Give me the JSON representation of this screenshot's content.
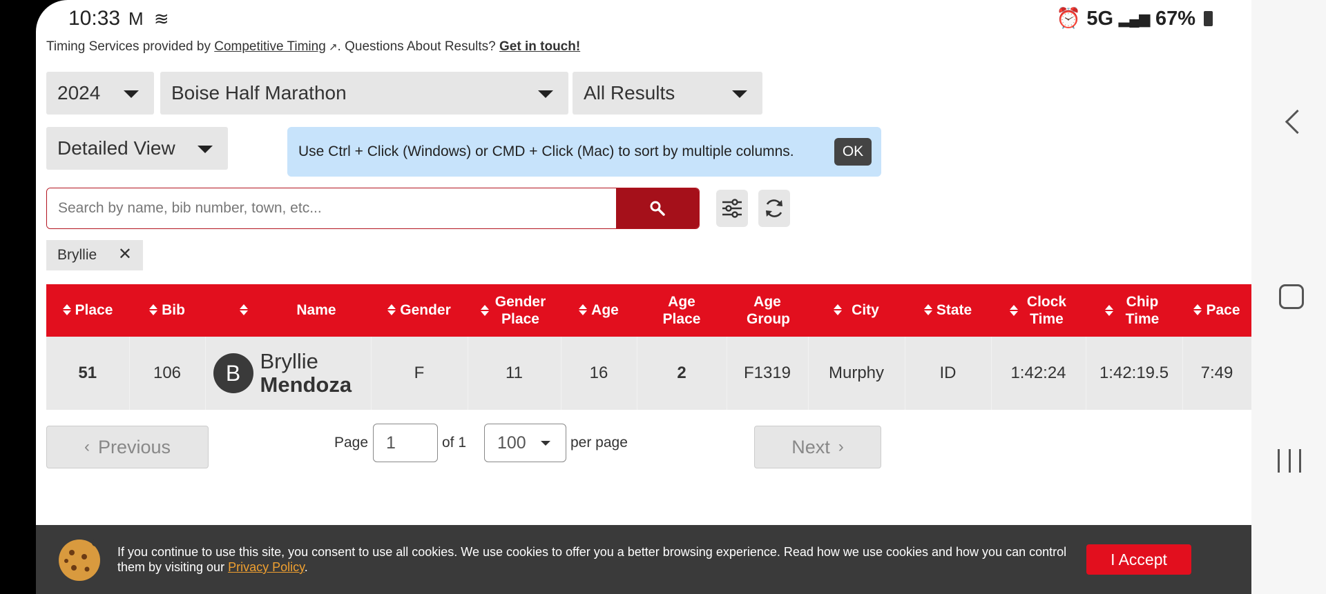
{
  "status_bar": {
    "time": "10:33",
    "left_icons": "M ≋",
    "network": "5G",
    "battery": "67%"
  },
  "credit": {
    "prefix": "Timing Services provided by ",
    "link": "Competitive Timing",
    "middle": ". Questions About Results? ",
    "contact": "Get in touch!"
  },
  "filters": {
    "year": "2024",
    "race": "Boise Half Marathon",
    "results": "All Results",
    "view": "Detailed View"
  },
  "tip": {
    "text": "Use Ctrl + Click (Windows) or CMD + Click (Mac) to sort by multiple columns.",
    "ok": "OK"
  },
  "search": {
    "placeholder": "Search by name, bib number, town, etc...",
    "value": ""
  },
  "active_filter": {
    "label": "Bryllie",
    "remove": "✕"
  },
  "table": {
    "headers": [
      "Place",
      "Bib",
      "Name",
      "Gender",
      "Gender Place",
      "Age",
      "Age Place",
      "Age Group",
      "City",
      "State",
      "Clock Time",
      "Chip Time",
      "Pace"
    ],
    "row": {
      "place": "51",
      "bib": "106",
      "avatar": "B",
      "first": "Bryllie",
      "last": "Mendoza",
      "gender": "F",
      "gender_place": "11",
      "age": "16",
      "age_place": "2",
      "age_group": "F1319",
      "city": "Murphy",
      "state": "ID",
      "clock_time": "1:42:24",
      "chip_time": "1:42:19.5",
      "pace": "7:49"
    }
  },
  "pager": {
    "previous": "Previous",
    "page_label": "Page",
    "page_value": "1",
    "of_label": "of 1",
    "per_page_value": "100",
    "per_page_label": "per page",
    "next": "Next"
  },
  "cookie": {
    "text": "If you continue to use this site, you consent to use all cookies. We use cookies to offer you a better browsing experience. Read how we use cookies and how you can control them by visiting our ",
    "link": "Privacy Policy",
    "end": ".",
    "accept": "I Accept"
  },
  "colors": {
    "accent": "#e20f1e",
    "search_button": "#a5101a",
    "tip_bg": "#c7e3fb"
  }
}
